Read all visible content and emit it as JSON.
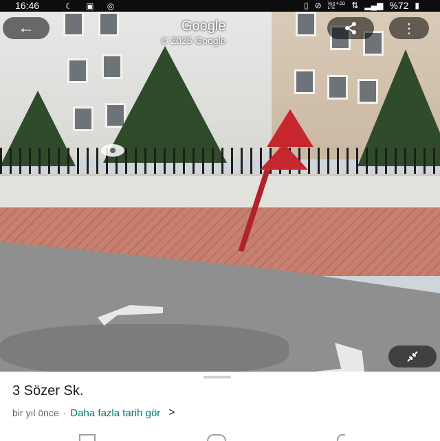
{
  "statusbar": {
    "time": "16:46",
    "left_icons": [
      "moon-icon",
      "image-icon",
      "instagram-icon"
    ],
    "right_icons": [
      "vibrate-icon",
      "mute-icon",
      "volte-icon",
      "network-icon",
      "signal-icon"
    ],
    "network_line1": "Vo)) 4.5G",
    "network_line2": "LTE",
    "battery_text": "%72"
  },
  "viewer": {
    "brand": "Google",
    "copyright": "© 2025 Google"
  },
  "controls": {
    "back_icon": "arrow-left-icon",
    "share_icon": "share-icon",
    "more_icon": "more-vert-icon",
    "minimize_icon": "collapse-icon"
  },
  "place": {
    "street_name": "3 Sözer Sk.",
    "timeline_text": "bir yıl önce",
    "separator": "·",
    "history_link": "Daha fazla tarih gör",
    "history_chevron": ">"
  }
}
